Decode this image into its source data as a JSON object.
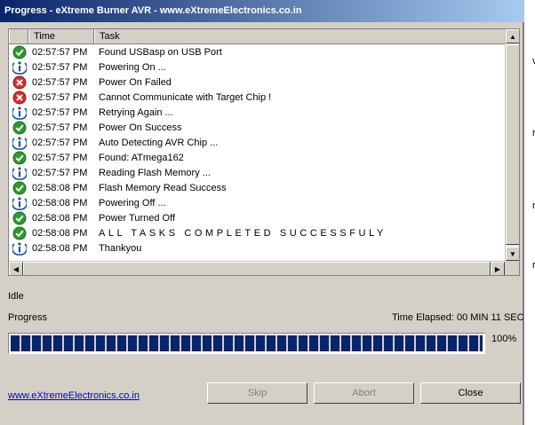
{
  "window": {
    "title": "Progress - eXtreme Burner AVR - www.eXtremeElectronics.co.in"
  },
  "list": {
    "headers": {
      "time": "Time",
      "task": "Task"
    },
    "rows": [
      {
        "icon": "check",
        "time": "02:57:57 PM",
        "task": "Found USBasp on USB Port"
      },
      {
        "icon": "info",
        "time": "02:57:57 PM",
        "task": "Powering On ..."
      },
      {
        "icon": "error",
        "time": "02:57:57 PM",
        "task": "Power On Failed"
      },
      {
        "icon": "error",
        "time": "02:57:57 PM",
        "task": "Cannot Communicate with Target Chip !"
      },
      {
        "icon": "info",
        "time": "02:57:57 PM",
        "task": "Retrying Again ..."
      },
      {
        "icon": "check",
        "time": "02:57:57 PM",
        "task": "Power On Success"
      },
      {
        "icon": "info",
        "time": "02:57:57 PM",
        "task": "Auto Detecting AVR Chip ..."
      },
      {
        "icon": "check",
        "time": "02:57:57 PM",
        "task": "Found: ATmega162"
      },
      {
        "icon": "info",
        "time": "02:57:57 PM",
        "task": "Reading Flash Memory ..."
      },
      {
        "icon": "check",
        "time": "02:58:08 PM",
        "task": "Flash Memory Read Success"
      },
      {
        "icon": "info",
        "time": "02:58:08 PM",
        "task": "Powering Off ..."
      },
      {
        "icon": "check",
        "time": "02:58:08 PM",
        "task": "Power Turned Off"
      },
      {
        "icon": "check",
        "time": "02:58:08 PM",
        "task": "ALL TASKS COMPLETED SUCCESSFULY"
      },
      {
        "icon": "info",
        "time": "02:58:08 PM",
        "task": "Thankyou"
      }
    ]
  },
  "status": "Idle",
  "progress": {
    "label": "Progress",
    "elapsed": "Time Elapsed: 00 MIN  11 SEC",
    "percent_text": "100%",
    "value": 100
  },
  "buttons": {
    "skip": "Skip",
    "abort": "Abort",
    "close": "Close"
  },
  "link": "www.eXtremeElectronics.co.in",
  "edge_chars": [
    "v",
    "r",
    "r",
    "r"
  ],
  "colors": {
    "titlebar": "#0a246a",
    "progress_fill": "#0a246a",
    "success": "#2e9a2e",
    "error": "#d03030",
    "info": "#1a4fb0"
  }
}
